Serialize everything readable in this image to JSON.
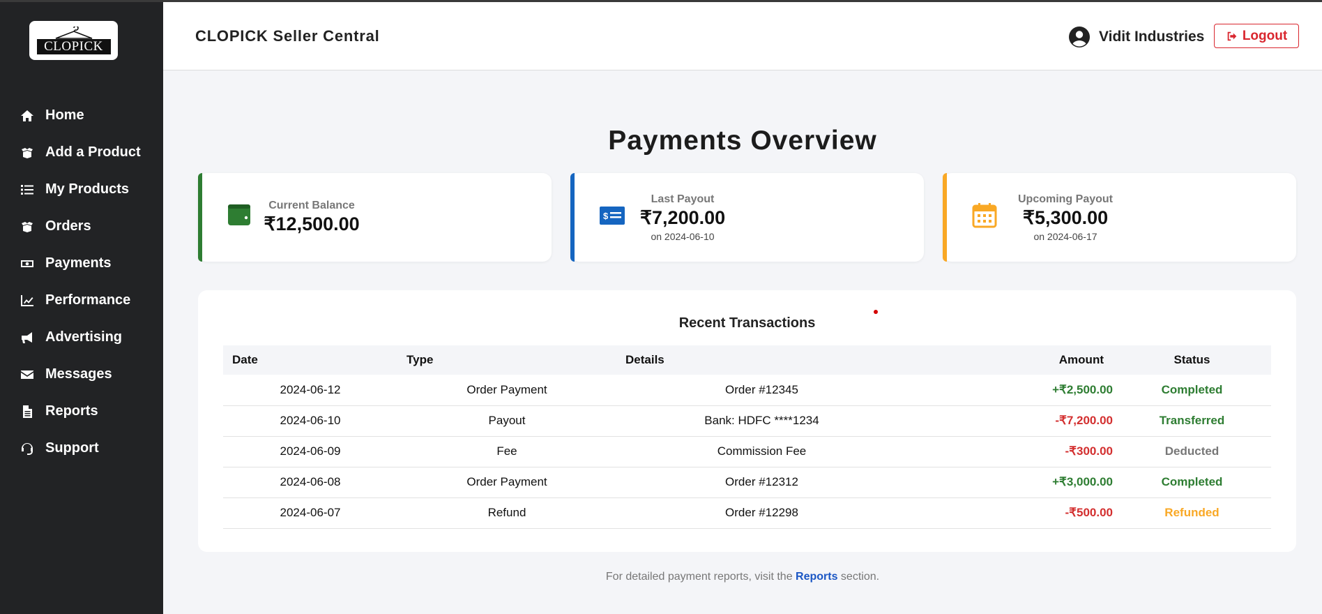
{
  "app": {
    "logo_text": "CLOPICK",
    "header_title": "CLOPICK Seller Central",
    "user_name": "Vidit Industries",
    "logout_label": "Logout"
  },
  "sidebar": {
    "items": [
      {
        "label": "Home",
        "icon": "home-icon"
      },
      {
        "label": "Add a Product",
        "icon": "box-open-icon"
      },
      {
        "label": "My Products",
        "icon": "list-icon"
      },
      {
        "label": "Orders",
        "icon": "box-open-icon"
      },
      {
        "label": "Payments",
        "icon": "money-bill-icon"
      },
      {
        "label": "Performance",
        "icon": "chart-line-icon"
      },
      {
        "label": "Advertising",
        "icon": "megaphone-icon"
      },
      {
        "label": "Messages",
        "icon": "envelope-icon"
      },
      {
        "label": "Reports",
        "icon": "file-icon"
      },
      {
        "label": "Support",
        "icon": "headset-icon"
      }
    ]
  },
  "main": {
    "title": "Payments Overview",
    "cards": [
      {
        "label": "Current Balance",
        "value": "₹12,500.00",
        "sub": "",
        "icon": "wallet-icon",
        "color": "#2e7d32"
      },
      {
        "label": "Last Payout",
        "value": "₹7,200.00",
        "sub": "on 2024-06-10",
        "icon": "money-check-icon",
        "color": "#1565c0"
      },
      {
        "label": "Upcoming Payout",
        "value": "₹5,300.00",
        "sub": "on 2024-06-17",
        "icon": "calendar-icon",
        "color": "#f9a825"
      }
    ],
    "transactions": {
      "title": "Recent Transactions",
      "columns": [
        "Date",
        "Type",
        "Details",
        "Amount",
        "Status"
      ],
      "rows": [
        {
          "date": "2024-06-12",
          "type": "Order Payment",
          "details": "Order #12345",
          "amount": "+₹2,500.00",
          "amount_color": "#2e7d32",
          "status": "Completed",
          "status_color": "#2e7d32"
        },
        {
          "date": "2024-06-10",
          "type": "Payout",
          "details": "Bank: HDFC ****1234",
          "amount": "-₹7,200.00",
          "amount_color": "#d32f2f",
          "status": "Transferred",
          "status_color": "#2e7d32"
        },
        {
          "date": "2024-06-09",
          "type": "Fee",
          "details": "Commission Fee",
          "amount": "-₹300.00",
          "amount_color": "#d32f2f",
          "status": "Deducted",
          "status_color": "#777777"
        },
        {
          "date": "2024-06-08",
          "type": "Order Payment",
          "details": "Order #12312",
          "amount": "+₹3,000.00",
          "amount_color": "#2e7d32",
          "status": "Completed",
          "status_color": "#2e7d32"
        },
        {
          "date": "2024-06-07",
          "type": "Refund",
          "details": "Order #12298",
          "amount": "-₹500.00",
          "amount_color": "#d32f2f",
          "status": "Refunded",
          "status_color": "#f9a825"
        }
      ]
    },
    "footer": {
      "before": "For detailed payment reports, visit the ",
      "link": "Reports",
      "after": " section."
    }
  }
}
